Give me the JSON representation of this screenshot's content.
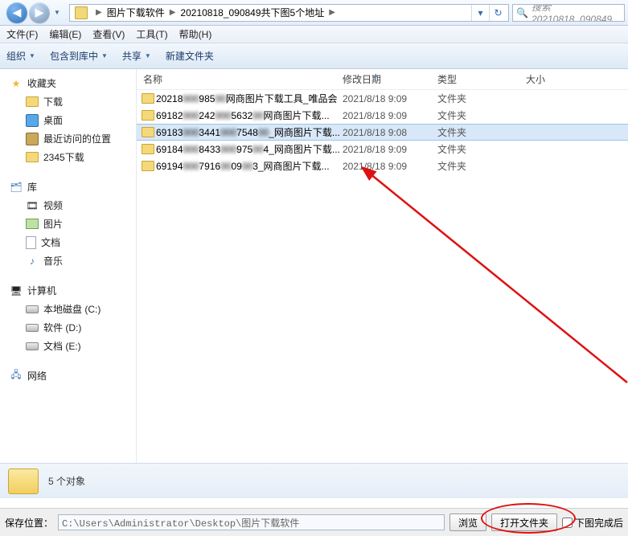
{
  "nav": {
    "breadcrumb": [
      "图片下载软件",
      "20210818_090849共下图5个地址"
    ],
    "search_placeholder": "搜索 20210818_090849"
  },
  "menu": {
    "file": "文件(F)",
    "edit": "编辑(E)",
    "view": "查看(V)",
    "tools": "工具(T)",
    "help": "帮助(H)"
  },
  "toolbar": {
    "organize": "组织",
    "include": "包含到库中",
    "share": "共享",
    "newfolder": "新建文件夹"
  },
  "sidebar": {
    "favorites": {
      "title": "收藏夹",
      "items": [
        "下载",
        "桌面",
        "最近访问的位置",
        "2345下载"
      ]
    },
    "libraries": {
      "title": "库",
      "items": [
        "视频",
        "图片",
        "文档",
        "音乐"
      ]
    },
    "computer": {
      "title": "计算机",
      "items": [
        "本地磁盘 (C:)",
        "软件 (D:)",
        "文档 (E:)"
      ]
    },
    "network": {
      "title": "网络"
    }
  },
  "columns": {
    "name": "名称",
    "date": "修改日期",
    "type": "类型",
    "size": "大小"
  },
  "rows": [
    {
      "name": "20218███985██网商图片下载工具_唯品会",
      "date": "2021/8/18 9:09",
      "type": "文件夹"
    },
    {
      "name": "69182███242███5632██网商图片下载...",
      "date": "2021/8/18 9:09",
      "type": "文件夹"
    },
    {
      "name": "69183███3441███7548██_网商图片下载...",
      "date": "2021/8/18 9:08",
      "type": "文件夹",
      "selected": true
    },
    {
      "name": "69184███8433███975██4_网商图片下载...",
      "date": "2021/8/18 9:09",
      "type": "文件夹"
    },
    {
      "name": "69194███7916██09██3_网商图片下载...",
      "date": "2021/8/18 9:09",
      "type": "文件夹"
    }
  ],
  "status": {
    "count": "5 个对象"
  },
  "bottom": {
    "label": "保存位置：",
    "path": "C:\\Users\\Administrator\\Desktop\\图片下载软件",
    "browse": "浏览",
    "open": "打开文件夹",
    "chk1": "下图完成后"
  }
}
